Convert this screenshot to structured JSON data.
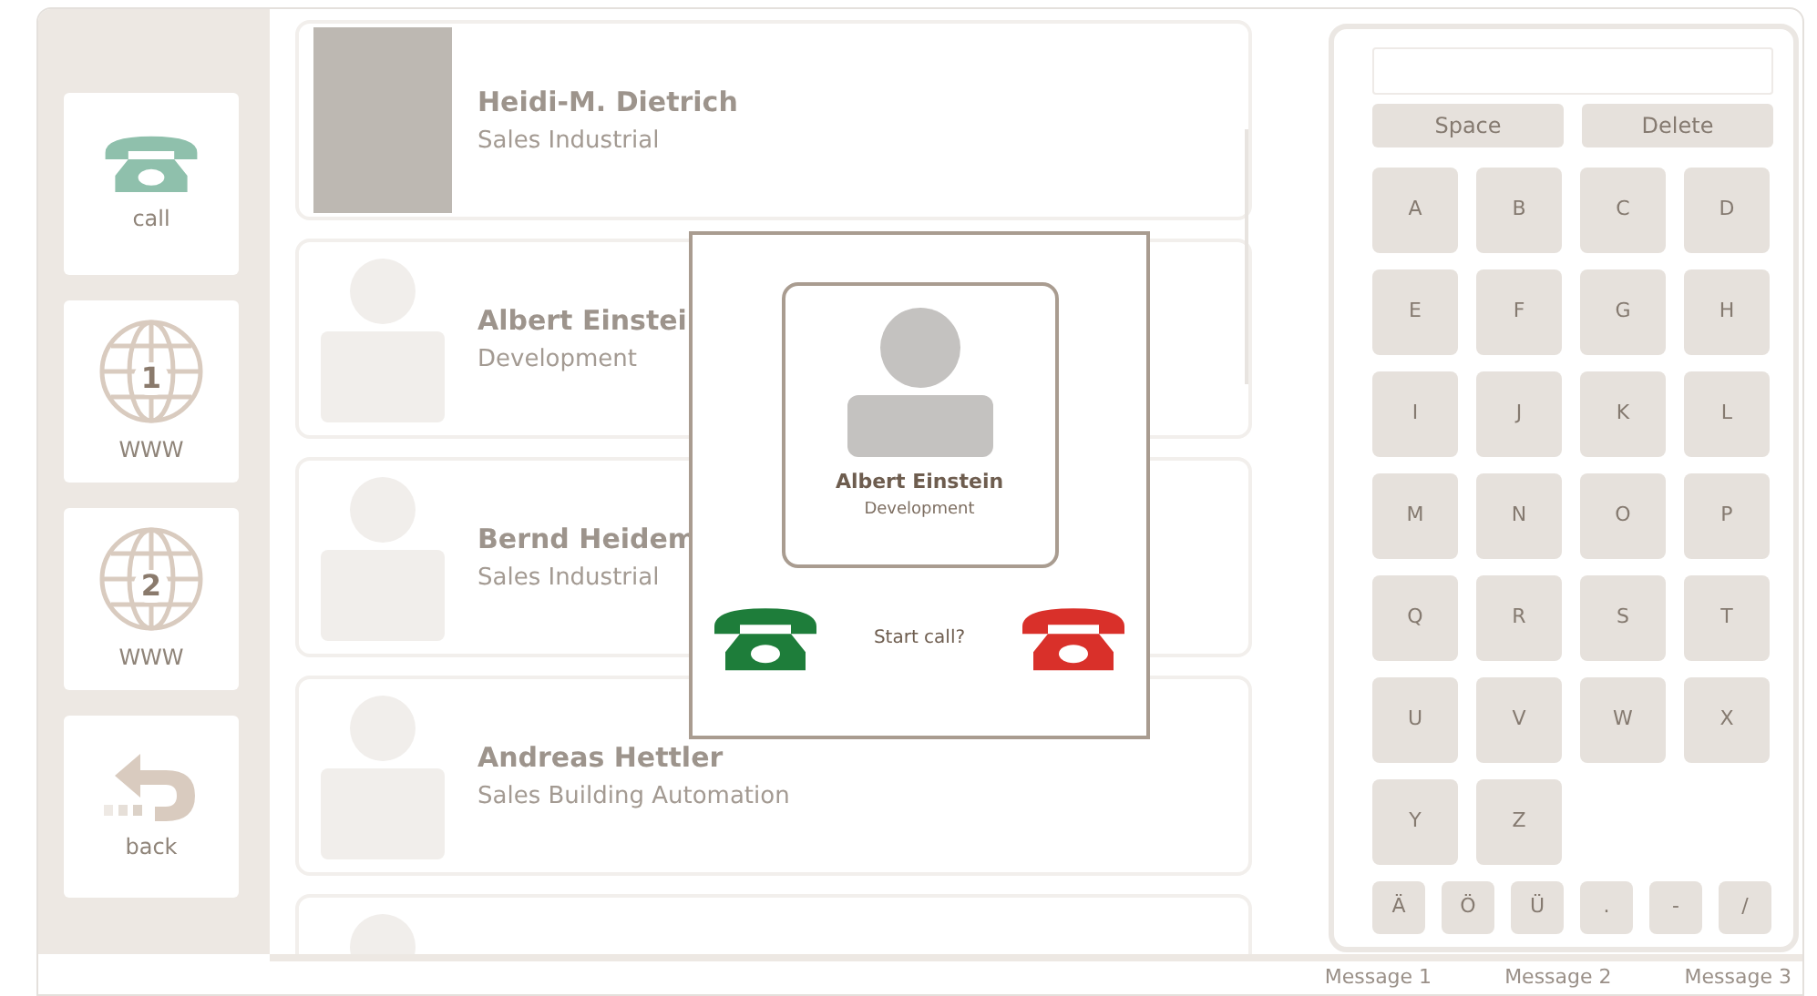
{
  "sidebar": {
    "items": [
      {
        "kind": "phone",
        "label": "call"
      },
      {
        "kind": "globe",
        "number": "1",
        "label": "WWW"
      },
      {
        "kind": "globe",
        "number": "2",
        "label": "WWW"
      },
      {
        "kind": "back",
        "label": "back"
      }
    ]
  },
  "contacts": [
    {
      "kind": "photo",
      "name": "Heidi-M. Dietrich",
      "department": "Sales Industrial"
    },
    {
      "kind": "silhouette",
      "name": "Albert Einstei",
      "department": "Development"
    },
    {
      "kind": "silhouette",
      "name": "Bernd Heidem",
      "department": "Sales Industrial"
    },
    {
      "kind": "silhouette",
      "name": "Andreas Hettler",
      "department": "Sales Building Automation"
    },
    {
      "kind": "silhouette"
    }
  ],
  "dialog": {
    "name": "Albert Einstein",
    "department": "Development",
    "prompt": "Start call?"
  },
  "keyboard": {
    "wide_keys": [
      "Space",
      "Delete"
    ],
    "keys": [
      "A",
      "B",
      "C",
      "D",
      "E",
      "F",
      "G",
      "H",
      "I",
      "J",
      "K",
      "L",
      "M",
      "N",
      "O",
      "P",
      "Q",
      "R",
      "S",
      "T",
      "U",
      "V",
      "W",
      "X",
      "Y",
      "Z"
    ],
    "small_keys": [
      "Ä",
      "Ö",
      "Ü",
      ".",
      "-",
      "/"
    ]
  },
  "status_bar": {
    "messages": [
      "Message 1",
      "Message 2",
      "Message 3"
    ]
  }
}
